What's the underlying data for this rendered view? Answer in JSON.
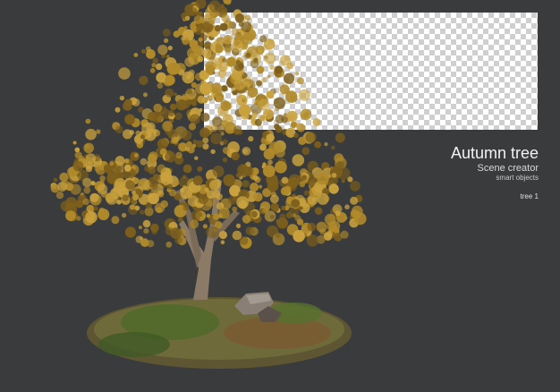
{
  "labels": {
    "title": "Autumn tree",
    "subtitle": "Scene creator",
    "caption": "smart objects",
    "tag": "tree 1"
  },
  "colors": {
    "background": "#3a3b3d",
    "foliage": "#b08a2a",
    "foliage_light": "#c9a23e",
    "foliage_dark": "#7d5f1c",
    "trunk": "#8b7a66",
    "ground": "#6f6a3a",
    "grass": "#4e6a2a",
    "rock": "#8a7f76"
  },
  "icons": [
    "transparency-checker"
  ]
}
